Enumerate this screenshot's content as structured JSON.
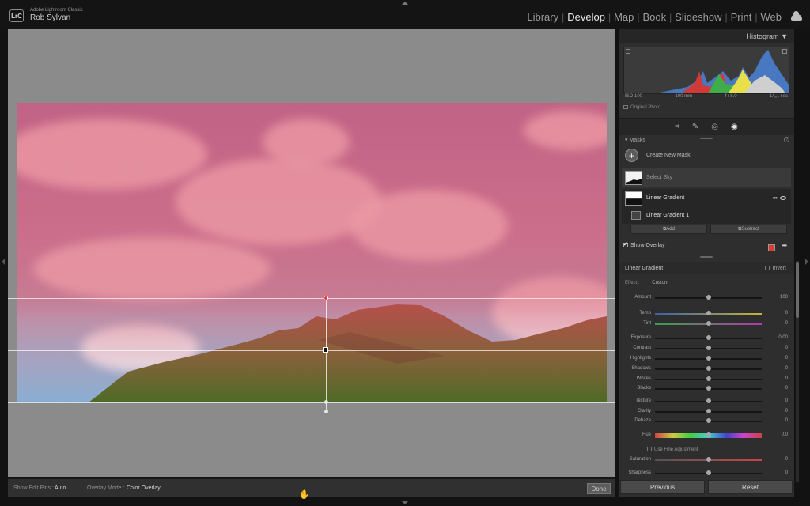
{
  "app": {
    "logo": "LrC",
    "name": "Adobe Lightroom Classic",
    "user": "Rob Sylvan"
  },
  "modules": [
    {
      "label": "Library",
      "active": false
    },
    {
      "label": "Develop",
      "active": true
    },
    {
      "label": "Map",
      "active": false
    },
    {
      "label": "Book",
      "active": false
    },
    {
      "label": "Slideshow",
      "active": false
    },
    {
      "label": "Print",
      "active": false
    },
    {
      "label": "Web",
      "active": false
    }
  ],
  "toolbar": {
    "edit_pins_label": "Show Edit Pins :",
    "edit_pins_value": "Auto",
    "overlay_mode_label": "Overlay Mode :",
    "overlay_mode_value": "Color Overlay",
    "done_label": "Done"
  },
  "histogram": {
    "title": "Histogram",
    "iso": "ISO 100",
    "focal": "100 mm",
    "aperture": "f / 8.0",
    "shutter": "1/₁₆₀ sec",
    "original_photo": "Original Photo"
  },
  "masks": {
    "section_label": "Masks",
    "create_label": "Create New Mask",
    "items": [
      {
        "label": "Select Sky"
      },
      {
        "label": "Linear Gradient"
      },
      {
        "label": "Linear Gradient 1"
      }
    ],
    "add_label": "Add",
    "subtract_label": "Subtract",
    "show_overlay_label": "Show Overlay",
    "overlay_color": "#dd3a32"
  },
  "gradient_panel": {
    "title": "Linear Gradient",
    "invert_label": "Invert",
    "effect_label": "Effect :",
    "effect_value": "Custom",
    "fine_adjustment_label": "Use Fine Adjustment"
  },
  "sliders": [
    {
      "label": "Amount",
      "value": "100",
      "pos": 0.5
    },
    {
      "label": "Temp",
      "value": "0",
      "pos": 0.5
    },
    {
      "label": "Tint",
      "value": "0",
      "pos": 0.5
    },
    {
      "label": "Exposure",
      "value": "0.00",
      "pos": 0.5
    },
    {
      "label": "Contrast",
      "value": "0",
      "pos": 0.5
    },
    {
      "label": "Highlights",
      "value": "0",
      "pos": 0.5
    },
    {
      "label": "Shadows",
      "value": "0",
      "pos": 0.5
    },
    {
      "label": "Whites",
      "value": "0",
      "pos": 0.5
    },
    {
      "label": "Blacks",
      "value": "0",
      "pos": 0.5
    },
    {
      "label": "Texture",
      "value": "0",
      "pos": 0.5
    },
    {
      "label": "Clarity",
      "value": "0",
      "pos": 0.5
    },
    {
      "label": "Dehaze",
      "value": "0",
      "pos": 0.5
    },
    {
      "label": "Hue",
      "value": "0.0",
      "pos": 0.5
    },
    {
      "label": "Saturation",
      "value": "0",
      "pos": 0.5
    },
    {
      "label": "Sharpness",
      "value": "0",
      "pos": 0.5
    }
  ],
  "bottom_buttons": {
    "previous": "Previous",
    "reset": "Reset"
  }
}
